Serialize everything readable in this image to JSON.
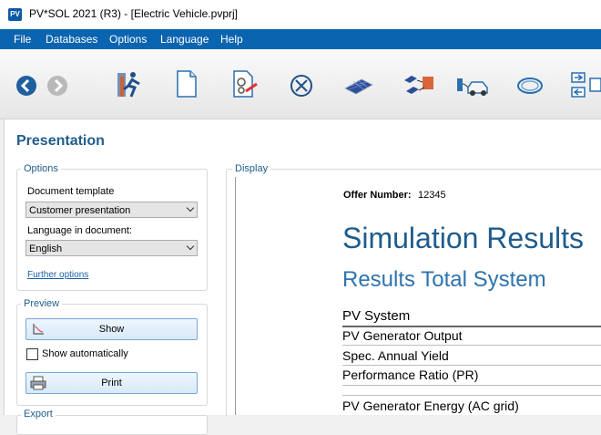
{
  "window": {
    "title": "PV*SOL 2021 (R3) - [Electric Vehicle.pvprj]",
    "logo_text": "PV"
  },
  "menu": [
    "File",
    "Databases",
    "Options",
    "Language",
    "Help"
  ],
  "toolbar": {
    "icons": [
      "back-arrow-icon",
      "forward-arrow-icon",
      "project-runner-icon",
      "document-icon",
      "settings-document-icon",
      "cancel-circle-icon",
      "pv-module-icon",
      "inverter-icon",
      "electric-vehicle-icon",
      "cable-icon",
      "grid-connection-icon"
    ]
  },
  "page": {
    "title": "Presentation"
  },
  "options": {
    "group_label": "Options",
    "template_label": "Document template",
    "template_value": "Customer presentation",
    "language_label": "Language in document:",
    "language_value": "English",
    "further_options": "Further options"
  },
  "preview": {
    "group_label": "Preview",
    "show_button": "Show",
    "show_auto_label": "Show automatically",
    "print_button": "Print"
  },
  "export": {
    "group_label": "Export"
  },
  "display": {
    "group_label": "Display",
    "offer_label": "Offer Number:",
    "offer_value": "12345",
    "heading": "Simulation Results",
    "subheading": "Results Total System",
    "section": "PV System",
    "rows": [
      "PV Generator Output",
      "Spec. Annual Yield",
      "Performance Ratio (PR)",
      "PV Generator Energy (AC grid)"
    ]
  },
  "colors": {
    "menubar": "#0a64b0",
    "heading": "#1f5c8c"
  }
}
